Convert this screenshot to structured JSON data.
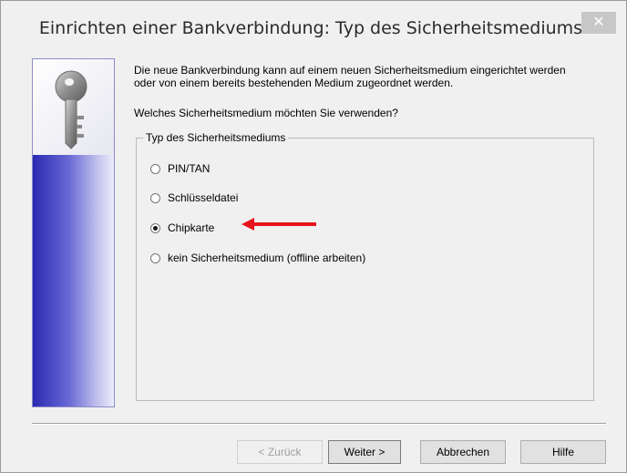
{
  "window": {
    "title": "Einrichten einer Bankverbindung: Typ des Sicherheitsmediums",
    "close_icon": "close-icon",
    "close_glyph": "✕"
  },
  "banner": {
    "icon": "key-icon"
  },
  "intro_text": "Die neue Bankverbindung kann  auf einem neuen Sicherheitsmedium eingerichtet werden oder von einem bereits bestehenden Medium zugeordnet werden.",
  "question": "Welches Sicherheitsmedium möchten Sie verwenden?",
  "group": {
    "legend": "Typ des Sicherheitsmediums",
    "options": [
      {
        "label": "PIN/TAN",
        "selected": false
      },
      {
        "label": "Schlüsseldatei",
        "selected": false
      },
      {
        "label": "Chipkarte",
        "selected": true
      },
      {
        "label": "kein Sicherheitsmedium (offline arbeiten)",
        "selected": false
      }
    ]
  },
  "annotation": {
    "icon": "red-arrow-icon",
    "color": "#e8141c"
  },
  "buttons": {
    "back": "< Zurück",
    "next": "Weiter >",
    "cancel": "Abbrechen",
    "help": "Hilfe"
  }
}
